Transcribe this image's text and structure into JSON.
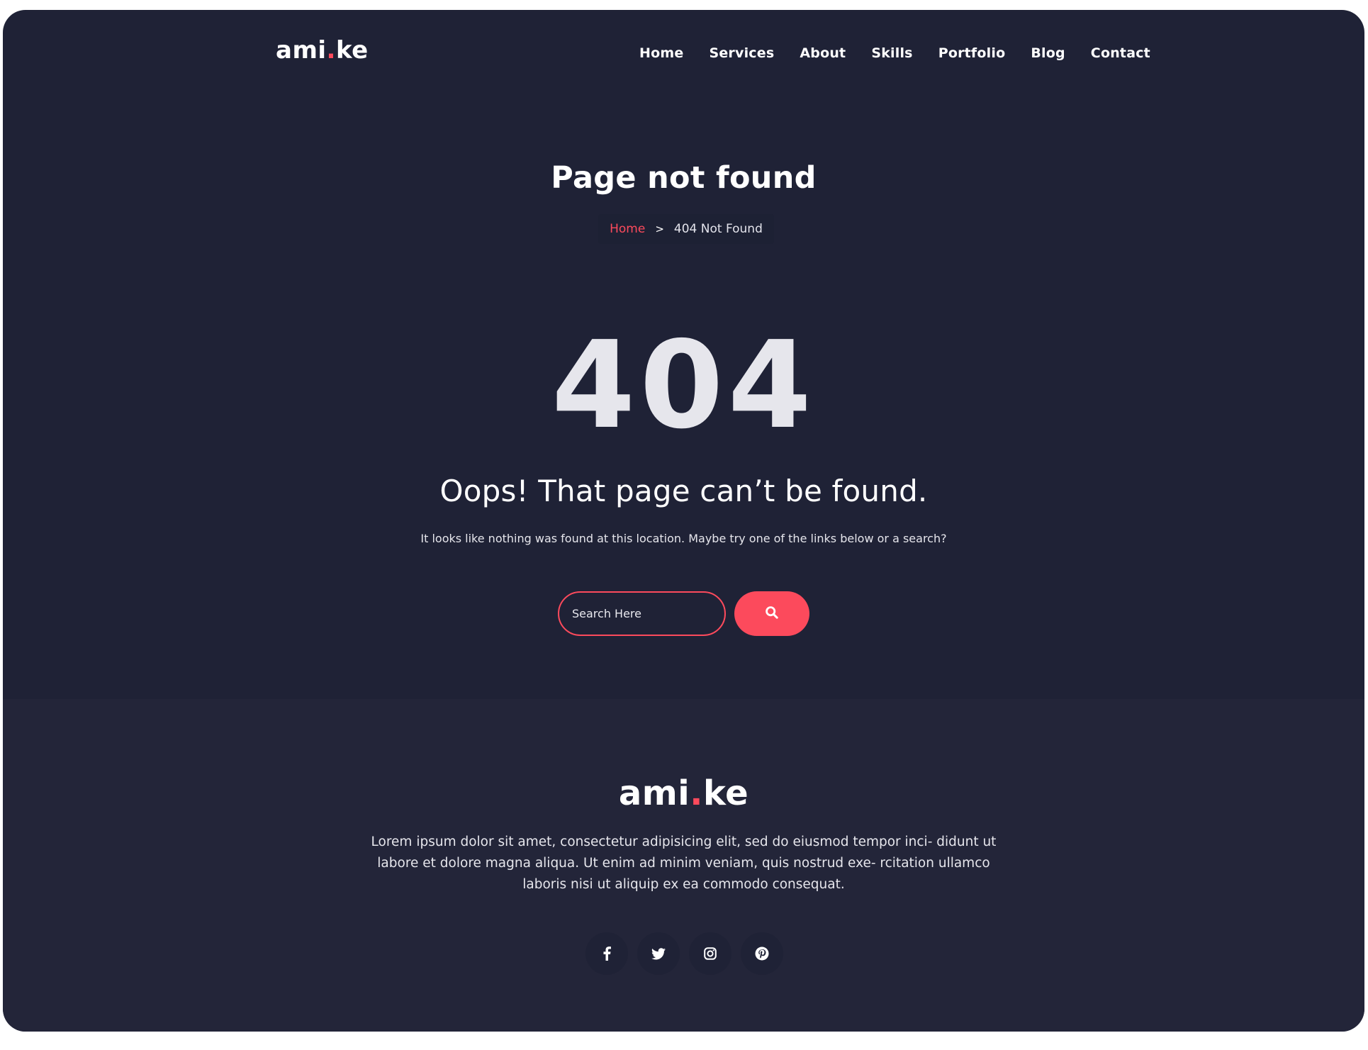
{
  "header": {
    "logo": {
      "part1": "ami",
      "dot": ".",
      "part2": "ke"
    },
    "nav": [
      "Home",
      "Services",
      "About",
      "Skills",
      "Portfolio",
      "Blog",
      "Contact"
    ]
  },
  "hero": {
    "title": "Page not found",
    "breadcrumb": {
      "home": "Home",
      "separator": ">",
      "current": "404 Not Found"
    },
    "error_code": "404",
    "heading": "Oops! That page can’t be found.",
    "description": "It looks like nothing was found at this location. Maybe try one of the links below or a search?",
    "search": {
      "placeholder": "Search Here",
      "button_icon": "search-icon"
    }
  },
  "footer": {
    "logo": {
      "part1": "ami",
      "dot": ".",
      "part2": "ke"
    },
    "text": "Lorem ipsum dolor sit amet, consectetur adipisicing elit, sed do eiusmod tempor inci- didunt ut labore et dolore magna aliqua. Ut enim ad minim veniam, quis nostrud exe- rcitation ullamco laboris nisi ut aliquip ex ea commodo consequat.",
    "social": [
      "facebook-icon",
      "twitter-icon",
      "instagram-icon",
      "pinterest-icon"
    ]
  },
  "colors": {
    "background": "#1f2236",
    "footer_background": "#232539",
    "accent": "#fc4a5c",
    "text": "#ffffff"
  }
}
